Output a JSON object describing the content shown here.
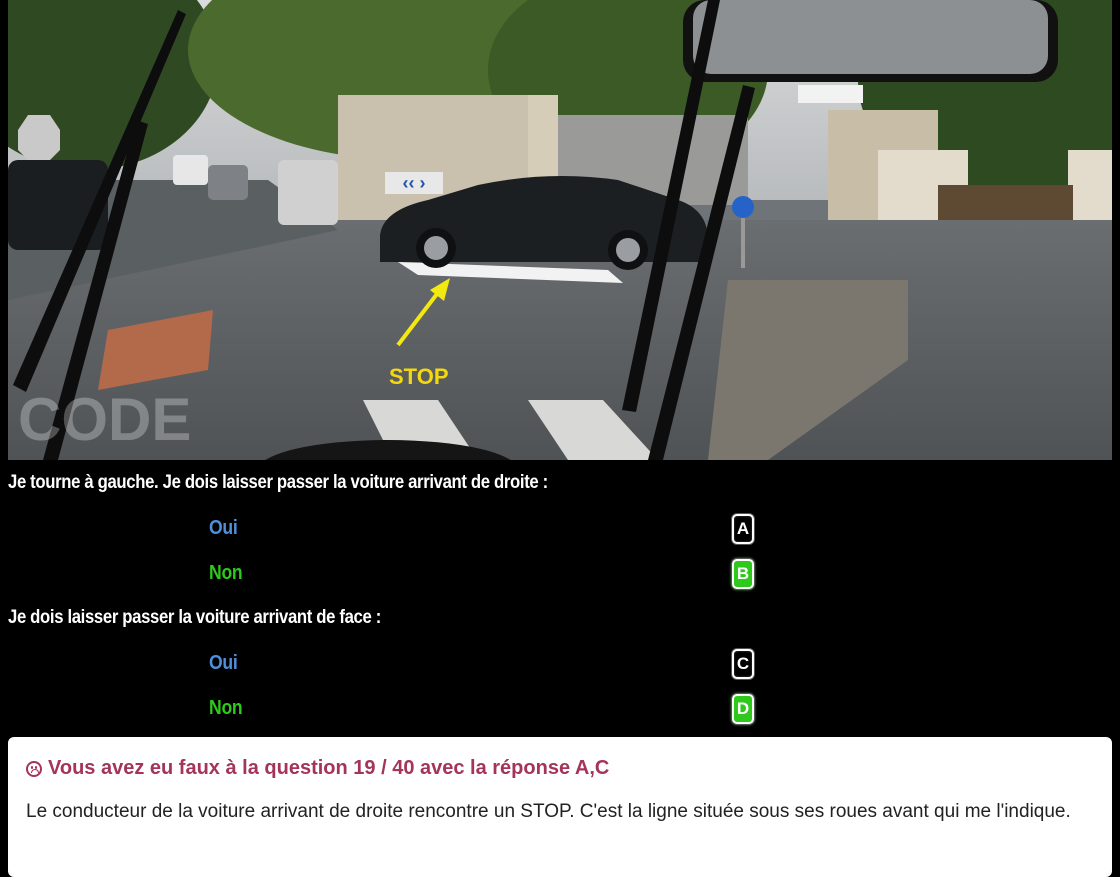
{
  "scene": {
    "annotation_label": "STOP",
    "sign_text": "",
    "watermark": "CODE"
  },
  "questions": [
    {
      "text": "Je tourne à gauche. Je dois laisser passer la voiture arrivant de droite :",
      "answers": [
        {
          "label": "Oui",
          "key": "A",
          "selected": true
        },
        {
          "label": "Non",
          "key": "B",
          "selected": false
        }
      ]
    },
    {
      "text": "Je dois laisser passer la voiture arrivant de face :",
      "answers": [
        {
          "label": "Oui",
          "key": "C",
          "selected": true
        },
        {
          "label": "Non",
          "key": "D",
          "selected": false
        }
      ]
    }
  ],
  "result": {
    "title": "Vous avez eu faux à la question 19 / 40 avec la réponse A,C",
    "explanation": "Le conducteur de la voiture arrivant de droite rencontre un STOP. C'est la ligne située sous ses roues avant qui me l'indique."
  },
  "colors": {
    "oui": "#4f8fdc",
    "non": "#2fc91c",
    "key_correct": "#2fc91c",
    "error_title": "#a4345a"
  }
}
